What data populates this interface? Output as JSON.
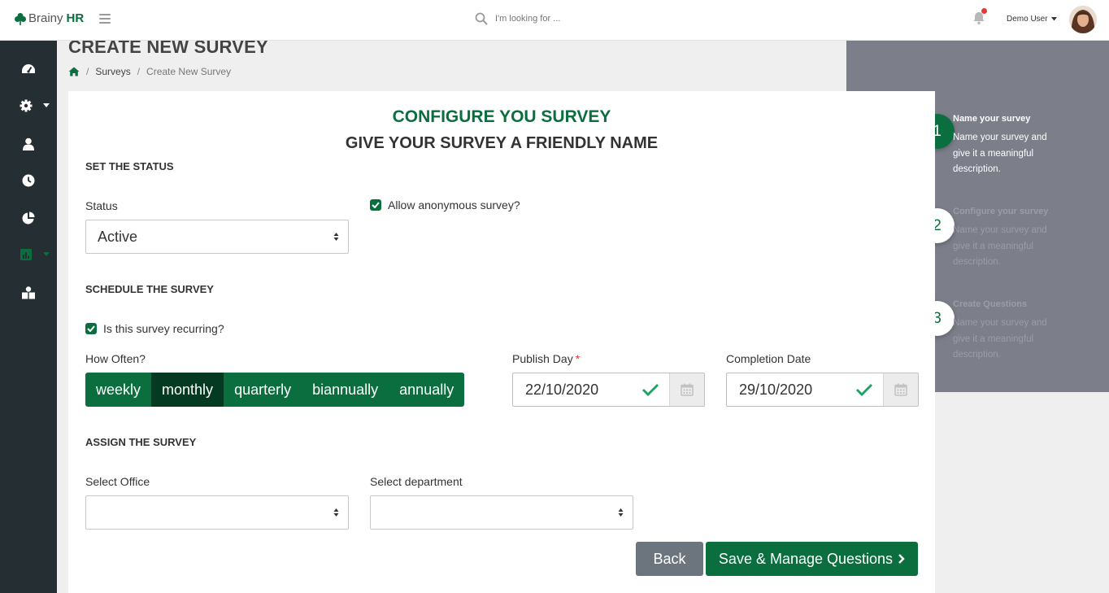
{
  "app": {
    "brand_a": "Brainy",
    "brand_b": "HR"
  },
  "search": {
    "placeholder": "I'm looking for ..."
  },
  "user": {
    "name": "Demo User"
  },
  "page": {
    "title": "CREATE NEW SURVEY",
    "breadcrumb": [
      "Surveys",
      "Create New Survey"
    ]
  },
  "card": {
    "heading": "CONFIGURE YOU SURVEY",
    "subheading": "GIVE YOUR SURVEY A FRIENDLY NAME"
  },
  "status_section": {
    "title": "SET THE STATUS",
    "status_label": "Status",
    "status_value": "Active",
    "anonymous_label": "Allow anonymous survey?",
    "anonymous_checked": true
  },
  "schedule_section": {
    "title": "SCHEDULE THE SURVEY",
    "recurring_label": "Is this survey recurring?",
    "recurring_checked": true,
    "how_often_label": "How Often?",
    "frequencies": [
      "weekly",
      "monthly",
      "quarterly",
      "biannually",
      "annually"
    ],
    "selected_frequency": "monthly",
    "publish_label": "Publish Day",
    "required_mark": "*",
    "publish_value": "22/10/2020",
    "completion_label": "Completion Date",
    "completion_value": "29/10/2020"
  },
  "assign_section": {
    "title": "ASSIGN THE SURVEY",
    "office_label": "Select Office",
    "office_value": "",
    "department_label": "Select department",
    "department_value": ""
  },
  "actions": {
    "back": "Back",
    "save": "Save & Manage Questions"
  },
  "steps": [
    {
      "number": "1",
      "title": "Name your survey",
      "desc": "Name your survey and give it a meaningful description.",
      "state": "active"
    },
    {
      "number": "2",
      "title": "Configure your survey",
      "desc": "Name your survey and give it a meaningful description.",
      "state": "inactive"
    },
    {
      "number": "3",
      "title": "Create Questions",
      "desc": "Name your survey and give it a meaningful description.",
      "state": "inactive"
    }
  ],
  "colors": {
    "primary": "#0b6e3f",
    "primary_dark": "#053a22",
    "sidebar": "#252e32",
    "steps_panel": "#7c7e8a",
    "back_button": "#6c757d"
  },
  "sidebar_icons": [
    "dashboard-icon",
    "settings-icon",
    "user-icon",
    "clock-icon",
    "pie-chart-icon",
    "bar-chart-icon",
    "team-icon"
  ]
}
